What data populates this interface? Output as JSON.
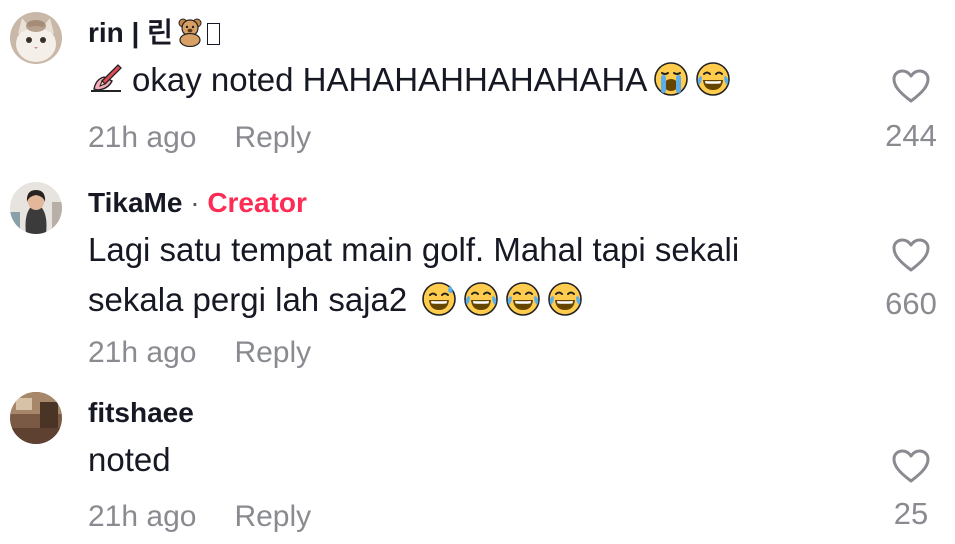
{
  "comments": [
    {
      "username": "rin | 린",
      "text": "okay noted HAHAHAHHAHAHAHA",
      "time": "21h ago",
      "reply_label": "Reply",
      "likes": "244",
      "leading_emoji": "writing-hand-icon",
      "trailing_emojis": [
        "loudly-crying-face-icon",
        "tears-of-joy-face-icon"
      ],
      "name_emojis": [
        "teddy-bear-icon",
        "missing-glyph-box"
      ]
    },
    {
      "username": "TikaMe",
      "separator": "·",
      "badge": "Creator",
      "text_line1": "Lagi satu tempat main golf. Mahal tapi sekali",
      "text_line2": "sekala pergi lah saja2",
      "time": "21h ago",
      "reply_label": "Reply",
      "likes": "660",
      "trailing_emojis": [
        "grinning-sweat-face-icon",
        "tears-of-joy-face-icon",
        "tears-of-joy-face-icon",
        "tears-of-joy-face-icon"
      ]
    },
    {
      "username": "fitshaee",
      "text": "noted",
      "time": "21h ago",
      "reply_label": "Reply",
      "likes": "25"
    }
  ],
  "colors": {
    "text": "#161823",
    "muted": "#8a8b91",
    "creator": "#fe2c55"
  }
}
